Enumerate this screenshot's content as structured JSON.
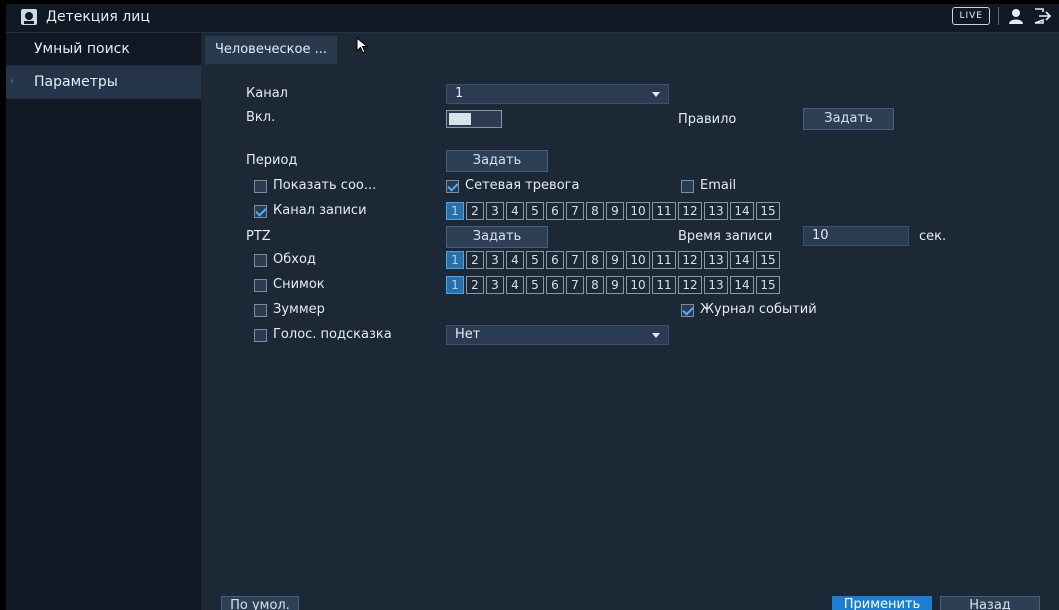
{
  "header": {
    "title": "Детекция лиц",
    "live_label": "LIVE",
    "icons": [
      "face-detection-icon",
      "user-icon",
      "logout-icon"
    ]
  },
  "sidebar": {
    "items": [
      {
        "label": "Умный поиск",
        "active": false
      },
      {
        "label": "Параметры",
        "active": true
      }
    ]
  },
  "tab": {
    "label": "Человеческое ..."
  },
  "form": {
    "channel_label": "Канал",
    "channel_value": "1",
    "enable_label": "Вкл.",
    "rule_label": "Правило",
    "rule_button": "Задать",
    "period_label": "Период",
    "period_button": "Задать",
    "show_message_label": "Показать соо...",
    "network_alarm_label": "Сетевая тревога",
    "email_label": "Email",
    "record_channel_label": "Канал записи",
    "ptz_label": "PTZ",
    "ptz_button": "Задать",
    "record_time_label": "Время записи",
    "record_time_value": "10",
    "record_time_unit": "сек.",
    "tour_label": "Обход",
    "snapshot_label": "Снимок",
    "buzzer_label": "Зуммер",
    "event_log_label": "Журнал событий",
    "voice_prompt_label": "Голос. подсказка",
    "voice_prompt_value": "Нет"
  },
  "checks": {
    "show_message": false,
    "network_alarm": true,
    "email": false,
    "record_channel": true,
    "tour": false,
    "snapshot": false,
    "buzzer": false,
    "event_log": true,
    "voice_prompt": false
  },
  "channels": [
    "1",
    "2",
    "3",
    "4",
    "5",
    "6",
    "7",
    "8",
    "9",
    "10",
    "11",
    "12",
    "13",
    "14",
    "15"
  ],
  "channel_rows": {
    "record": {
      "selected": [
        "1"
      ]
    },
    "tour": {
      "selected": [
        "1"
      ]
    },
    "snapshot": {
      "selected": [
        "1"
      ]
    }
  },
  "footer": {
    "default_button": "По умол.",
    "apply_button": "Применить",
    "back_button": "Назад"
  },
  "colors": {
    "accent": "#1a7fd0",
    "background": "#1c2836",
    "sidebar": "#0f1823"
  }
}
